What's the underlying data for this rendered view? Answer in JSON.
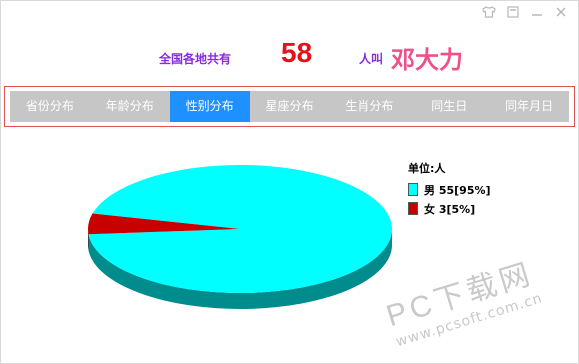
{
  "window": {
    "controls": [
      "skin-icon",
      "restore-icon",
      "minimize-icon",
      "close-icon"
    ]
  },
  "header": {
    "prefix": "全国各地共有",
    "count": "58",
    "mid": "人叫",
    "name": "邓大力"
  },
  "tabs": [
    {
      "label": "省份分布",
      "active": false
    },
    {
      "label": "年龄分布",
      "active": false
    },
    {
      "label": "性别分布",
      "active": true
    },
    {
      "label": "星座分布",
      "active": false
    },
    {
      "label": "生肖分布",
      "active": false
    },
    {
      "label": "同生日",
      "active": false
    },
    {
      "label": "同年月日",
      "active": false
    }
  ],
  "chart_data": {
    "type": "pie",
    "title": "",
    "legend_title": "单位:人",
    "legend_position": "top-right",
    "slices": [
      {
        "label": "男",
        "value": 55,
        "percent": 95,
        "legend": "男 55[95%]",
        "color": "#00ffff"
      },
      {
        "label": "女",
        "value": 3,
        "percent": 5,
        "legend": "女 3[5%]",
        "color": "#c80000"
      }
    ]
  },
  "watermark": {
    "main": "PC下载网",
    "url": "www.pcsoft.com.cn"
  },
  "colors": {
    "tab_bg": "#c6c6c6",
    "tab_active": "#1e90ff",
    "frame": "#e05252",
    "count": "#e8111b",
    "name": "#f0508a",
    "label": "#8a2be2"
  }
}
